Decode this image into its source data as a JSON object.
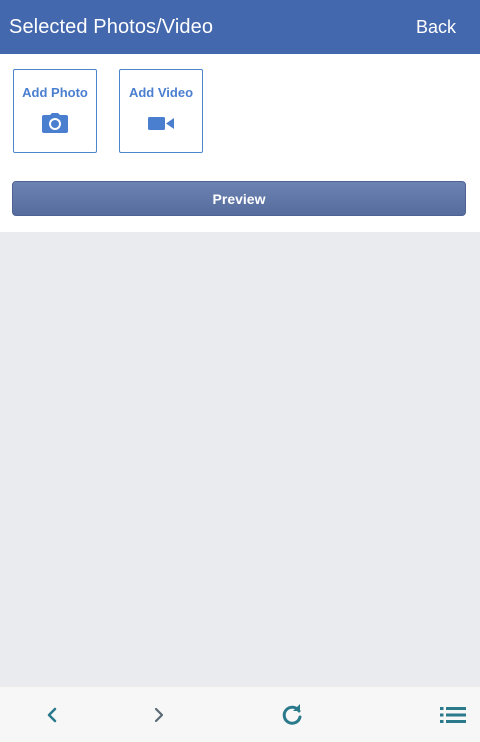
{
  "header": {
    "title": "Selected Photos/Video",
    "back_label": "Back"
  },
  "media": {
    "add_photo_label": "Add Photo",
    "add_video_label": "Add Video"
  },
  "preview_label": "Preview",
  "colors": {
    "header_bg": "#4468ad",
    "accent": "#4a7fd0",
    "preview_bg": "#5f76a8",
    "nav_icon": "#2b7a8c",
    "nav_icon_disabled": "#4f8fa0"
  },
  "icons": {
    "add_photo": "camera-icon",
    "add_video": "video-camera-icon",
    "nav_back": "chevron-left-icon",
    "nav_forward": "chevron-right-icon",
    "nav_refresh": "refresh-icon",
    "nav_menu": "list-icon"
  }
}
